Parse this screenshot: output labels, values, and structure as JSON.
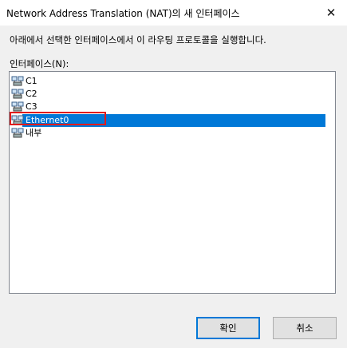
{
  "window": {
    "title": "Network Address Translation (NAT)의 새 인터페이스",
    "close_glyph": "✕"
  },
  "dialog": {
    "description": "아래에서 선택한 인터페이스에서 이 라우팅 프로토콜을 실행합니다.",
    "list_label": "인터페이스(N):",
    "interfaces": [
      {
        "label": "C1",
        "icon": "network-interface-icon"
      },
      {
        "label": "C2",
        "icon": "network-interface-icon"
      },
      {
        "label": "C3",
        "icon": "network-interface-icon"
      },
      {
        "label": "Ethernet0",
        "icon": "network-interface-icon",
        "selected": true,
        "highlighted": true
      },
      {
        "label": "내부",
        "icon": "network-interface-icon"
      }
    ]
  },
  "buttons": {
    "ok_label": "확인",
    "cancel_label": "취소"
  },
  "colors": {
    "selection": "#0078d7",
    "highlight_border": "#e01b1b"
  }
}
